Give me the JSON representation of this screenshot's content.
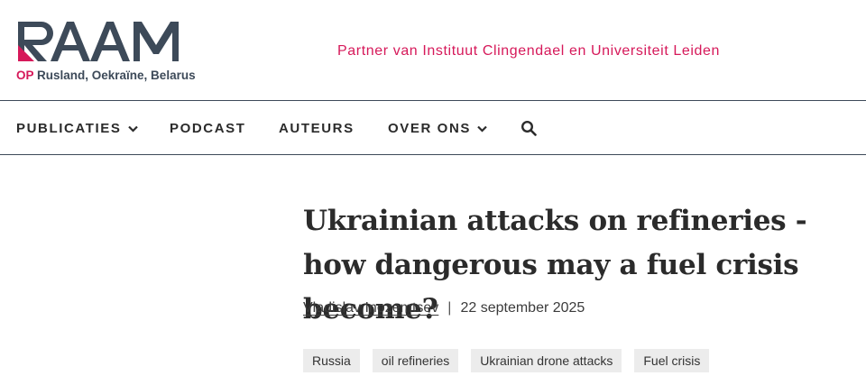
{
  "header": {
    "logo_subtitle_prefix": "OP",
    "logo_subtitle_rest": " Rusland, Oekraïne, Belarus",
    "partner_text": "Partner van Instituut Clingendael en Universiteit Leiden"
  },
  "nav": {
    "items": [
      {
        "label": "PUBLICATIES",
        "has_dropdown": true
      },
      {
        "label": "PODCAST",
        "has_dropdown": false
      },
      {
        "label": "AUTEURS",
        "has_dropdown": false
      },
      {
        "label": "OVER ONS",
        "has_dropdown": true
      }
    ],
    "search_icon": "search-icon"
  },
  "article": {
    "title": "Ukrainian attacks on refineries - how dangerous may a fuel crisis become?",
    "author": "Vladislav Inozemtsev",
    "separator": "|",
    "date": "22 september 2025",
    "tags": [
      "Russia",
      "oil refineries",
      "Ukrainian drone attacks",
      "Fuel crisis"
    ]
  },
  "colors": {
    "brand_dark": "#3d4a59",
    "brand_accent": "#d6195a",
    "tag_bg": "#ececec"
  }
}
